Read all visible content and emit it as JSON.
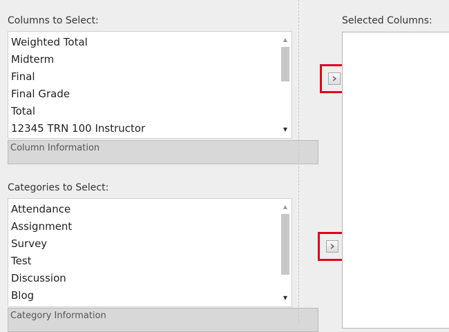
{
  "columns": {
    "label": "Columns to Select:",
    "items": [
      "Weighted Total",
      "Midterm",
      "Final",
      "Final Grade",
      "Total",
      "12345 TRN 100 Instructor"
    ],
    "info": "Column Information"
  },
  "categories": {
    "label": "Categories to Select:",
    "items": [
      "Attendance",
      "Assignment",
      "Survey",
      "Test",
      "Discussion",
      "Blog"
    ],
    "info": "Category Information"
  },
  "selected": {
    "label": "Selected Columns:"
  },
  "icons": {
    "move_columns": "chevron-right-icon",
    "move_categories": "chevron-right-icon"
  },
  "colors": {
    "highlight": "#e0001b",
    "background": "#eeeeee",
    "info_bar": "#d8d8d8"
  }
}
